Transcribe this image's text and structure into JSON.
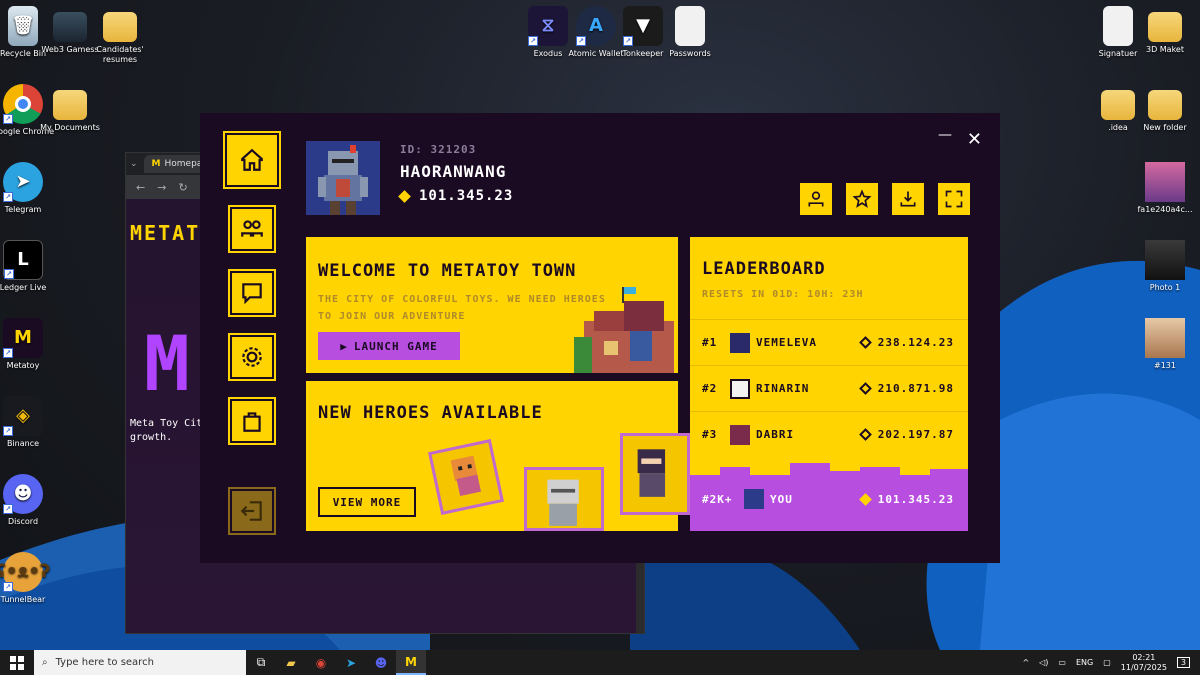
{
  "desktop": {
    "left_icons": [
      {
        "label": "Recycle Bin",
        "icon": "recycle-bin-icon"
      },
      {
        "label": "Web3 Gamess",
        "icon": "folder-icon"
      },
      {
        "label": "Candidates' resumes",
        "icon": "folder-icon"
      },
      {
        "label": "Google Chrome",
        "icon": "chrome-icon"
      },
      {
        "label": "My Documents",
        "icon": "folder-icon"
      },
      {
        "label": "Telegram",
        "icon": "telegram-icon"
      },
      {
        "label": "Ledger Live",
        "icon": "ledger-icon"
      },
      {
        "label": "Metatoy",
        "icon": "metatoy-icon"
      },
      {
        "label": "Binance",
        "icon": "binance-icon"
      },
      {
        "label": "Discord",
        "icon": "discord-icon"
      },
      {
        "label": "TunnelBear",
        "icon": "tunnelbear-icon"
      }
    ],
    "top_icons": [
      {
        "label": "Exodus",
        "icon": "exodus-icon"
      },
      {
        "label": "Atomic Wallet",
        "icon": "atomic-wallet-icon"
      },
      {
        "label": "Tonkeeper",
        "icon": "tonkeeper-icon"
      },
      {
        "label": "Passwords",
        "icon": "document-icon"
      }
    ],
    "right_icons": [
      {
        "label": "Signatuer",
        "icon": "document-icon"
      },
      {
        "label": "3D Maket",
        "icon": "folder-icon"
      },
      {
        "label": ".idea",
        "icon": "folder-icon"
      },
      {
        "label": "New folder",
        "icon": "folder-icon"
      },
      {
        "label": "fa1e240a4c...",
        "icon": "image-icon"
      },
      {
        "label": "Photo 1",
        "icon": "image-icon"
      },
      {
        "label": "#131",
        "icon": "image-icon"
      }
    ]
  },
  "browser": {
    "tab_title": "Homepag",
    "page_title": "METAT",
    "logo_letter": "M",
    "tagline_1": "Meta Toy Cit",
    "tagline_2": "growth."
  },
  "app": {
    "window": {
      "minimize": "—",
      "close": "✕"
    },
    "profile": {
      "id": "ID: 321203",
      "name": "HAORANWANG",
      "balance": "101.345.23"
    },
    "welcome": {
      "title": "WELCOME TO METATOY TOWN",
      "subtitle": "THE CITY OF COLORFUL TOYS. WE NEED HEROES TO JOIN OUR ADVENTURE",
      "button": "LAUNCH GAME"
    },
    "heroes": {
      "title": "NEW HEROES AVAILABLE",
      "button": "VIEW MORE"
    },
    "leaderboard": {
      "title": "LEADERBOARD",
      "reset": "RESETS IN 01D: 10H: 23H",
      "rows": [
        {
          "rank": "#1",
          "name": "VEMELEVA",
          "score": "238.124.23"
        },
        {
          "rank": "#2",
          "name": "RINARIN",
          "score": "210.871.98"
        },
        {
          "rank": "#3",
          "name": "DABRI",
          "score": "202.197.87"
        }
      ],
      "you": {
        "rank": "#2K+",
        "name": "YOU",
        "score": "101.345.23"
      }
    },
    "colors": {
      "accent": "#ffd400",
      "purple": "#b84ee0",
      "bg": "#1a0a22"
    }
  },
  "taskbar": {
    "search_placeholder": "Type here to search",
    "lang": "ENG",
    "time": "02:21",
    "date": "11/07/2025",
    "notifications": "3"
  }
}
